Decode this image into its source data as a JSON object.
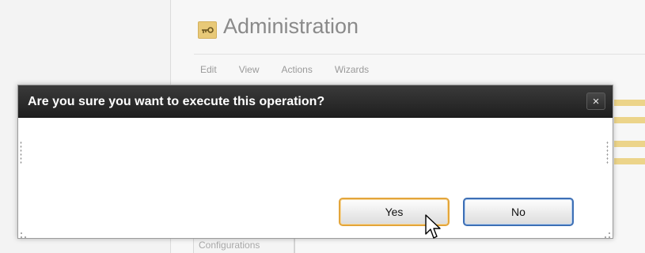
{
  "app": {
    "title": "Administration",
    "icon": "key-icon",
    "menu": [
      "Edit",
      "View",
      "Actions",
      "Wizards"
    ],
    "bottom_tab": "Configurations"
  },
  "dialog": {
    "title": "Are you sure you want to execute this operation?",
    "close_label": "×",
    "buttons": {
      "yes_label": "Yes",
      "no_label": "No"
    }
  },
  "colors": {
    "titlebar": "#2a2a2a",
    "yes_focus_border": "#e3a53a",
    "no_border": "#3d6fb5",
    "icon_bg": "#e8c978"
  }
}
